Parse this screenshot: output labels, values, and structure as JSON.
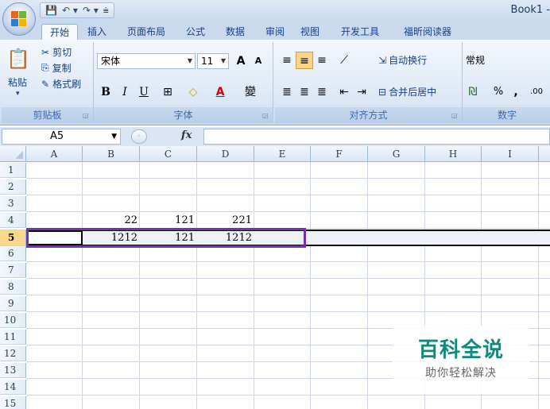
{
  "window": {
    "title": "Book1 -"
  },
  "qat": {
    "save_icon": "save-icon",
    "undo_label": "↶ ▾",
    "redo_label": "↷ ▾",
    "customize_label": "⩧"
  },
  "tabs": [
    {
      "label": "开始",
      "active": true
    },
    {
      "label": "插入"
    },
    {
      "label": "页面布局"
    },
    {
      "label": "公式"
    },
    {
      "label": "数据"
    },
    {
      "label": "审阅"
    },
    {
      "label": "视图"
    },
    {
      "label": "开发工具"
    },
    {
      "label": "福昕阅读器"
    }
  ],
  "clipboard": {
    "paste": "粘贴",
    "cut": "剪切",
    "copy": "复制",
    "format_painter": "格式刷",
    "group": "剪贴板"
  },
  "font": {
    "name": "宋体",
    "size": "11",
    "grow": "A",
    "shrink": "A",
    "bold": "B",
    "italic": "I",
    "underline": "U",
    "border": "⊞",
    "fill": "◇",
    "color": "A",
    "phonetic": "變",
    "group": "字体"
  },
  "alignment": {
    "wrap": "自动换行",
    "merge": "合并后居中",
    "group": "对齐方式"
  },
  "number": {
    "format": "常规",
    "percent": "%",
    "comma": ",",
    "decimal": ".00",
    "group": "数字"
  },
  "namebox": {
    "value": "A5"
  },
  "formula": {
    "fx": "fx",
    "value": ""
  },
  "grid": {
    "columns": [
      "A",
      "B",
      "C",
      "D",
      "E",
      "F",
      "G",
      "H",
      "I"
    ],
    "rows": [
      "1",
      "2",
      "3",
      "4",
      "5",
      "6",
      "7",
      "8",
      "9",
      "10",
      "11",
      "12",
      "13",
      "14",
      "15"
    ],
    "row4": {
      "B": "22",
      "C": "121",
      "D": "221"
    },
    "row5": {
      "B": "1212",
      "C": "121",
      "D": "1212"
    },
    "selected_row": "5"
  },
  "watermark": {
    "title": "百科全说",
    "subtitle": "助你轻松解决"
  },
  "colors": {
    "highlight": "#7b2fb0",
    "accent": "#15428b"
  }
}
